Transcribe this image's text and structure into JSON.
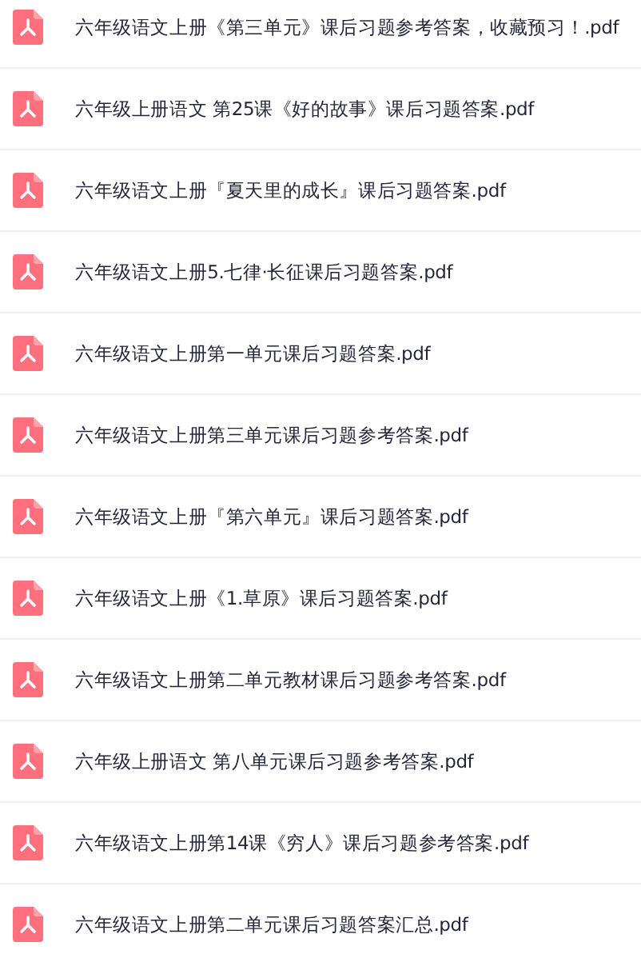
{
  "files": [
    {
      "name": "六年级语文上册《第三单元》课后习题参考答案，收藏预习！.pdf"
    },
    {
      "name": "六年级上册语文 第25课《好的故事》课后习题答案.pdf"
    },
    {
      "name": "六年级语文上册『夏天里的成长』课后习题答案.pdf"
    },
    {
      "name": "六年级语文上册5.七律·长征课后习题答案.pdf"
    },
    {
      "name": "六年级语文上册第一单元课后习题答案.pdf"
    },
    {
      "name": "六年级语文上册第三单元课后习题参考答案.pdf"
    },
    {
      "name": "六年级语文上册『第六单元』课后习题答案.pdf"
    },
    {
      "name": "六年级语文上册《1.草原》课后习题答案.pdf"
    },
    {
      "name": "六年级语文上册第二单元教材课后习题参考答案.pdf"
    },
    {
      "name": "六年级上册语文 第八单元课后习题参考答案.pdf"
    },
    {
      "name": "六年级语文上册第14课《穷人》课后习题参考答案.pdf"
    },
    {
      "name": "六年级语文上册第二单元课后习题答案汇总.pdf"
    }
  ]
}
